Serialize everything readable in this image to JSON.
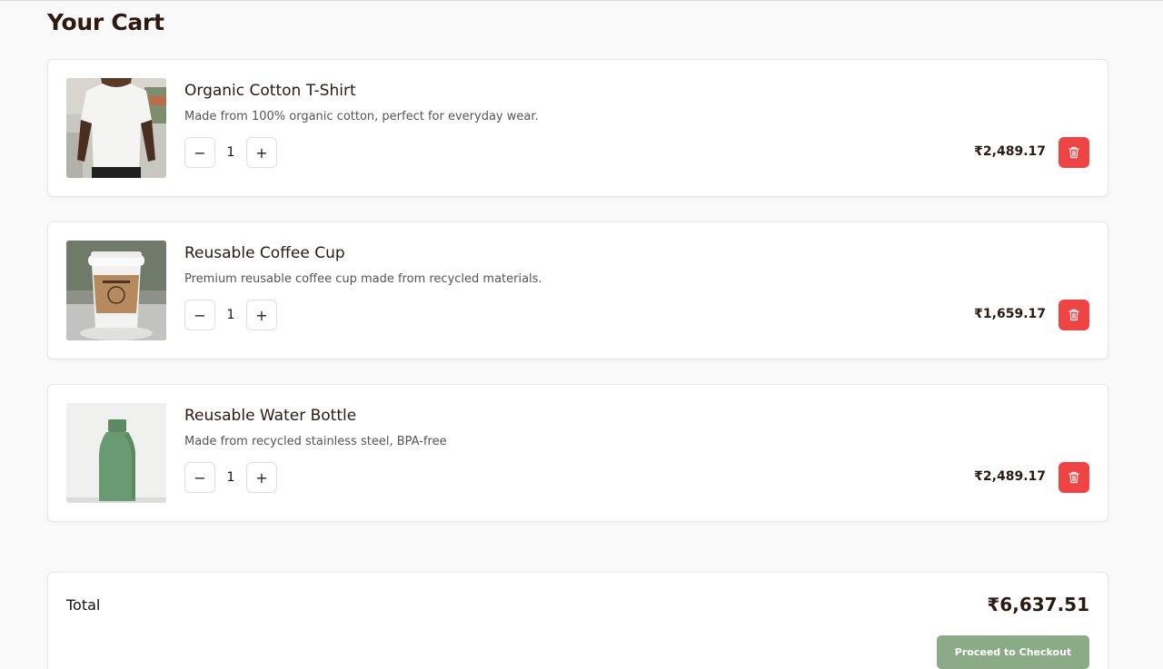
{
  "page": {
    "title": "Your Cart"
  },
  "items": [
    {
      "title": "Organic Cotton T-Shirt",
      "description": "Made from 100% organic cotton, perfect for everyday wear.",
      "quantity": "1",
      "price": "₹2,489.17",
      "image": "tshirt-photo"
    },
    {
      "title": "Reusable Coffee Cup",
      "description": "Premium reusable coffee cup made from recycled materials.",
      "quantity": "1",
      "price": "₹1,659.17",
      "image": "coffee-cup-photo"
    },
    {
      "title": "Reusable Water Bottle",
      "description": "Made from recycled stainless steel, BPA-free",
      "quantity": "1",
      "price": "₹2,489.17",
      "image": "water-bottle-photo"
    }
  ],
  "controls": {
    "minus": "−",
    "plus": "+"
  },
  "summary": {
    "total_label": "Total",
    "total_value": "₹6,637.51",
    "checkout_label": "Proceed to Checkout"
  },
  "colors": {
    "delete": "#ef4444",
    "checkout": "#8aab85",
    "background": "#f9f9f9"
  }
}
